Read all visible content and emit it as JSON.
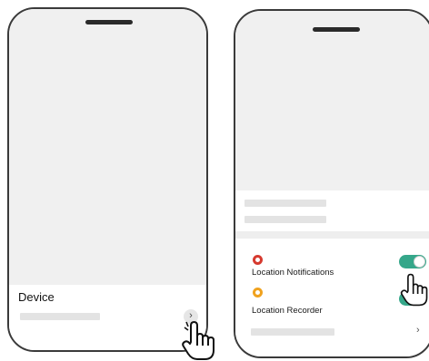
{
  "left_phone": {
    "sheet": {
      "device_label": "Device",
      "chevron": "›"
    }
  },
  "right_phone": {
    "rows": [
      {
        "label": "Location Notifications",
        "icon": "alert-icon",
        "icon_color": "#d63a2f",
        "toggle_on": true
      },
      {
        "label": "Location Recorder",
        "icon": "location-pin-icon",
        "icon_color": "#f0a21f",
        "toggle_on": true
      }
    ],
    "chevron": "›"
  },
  "colors": {
    "toggle_on": "#35a78a",
    "screen_bg": "#f0f0f0",
    "placeholder": "#e3e3e3"
  }
}
